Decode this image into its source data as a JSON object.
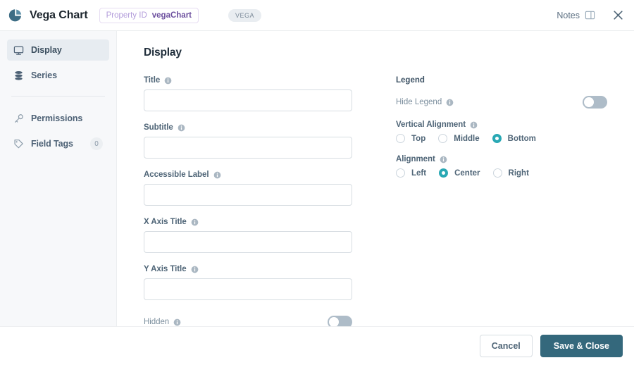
{
  "header": {
    "logo_icon": "pie-chart-icon",
    "title": "Vega Chart",
    "property_pill": {
      "label": "Property ID",
      "value": "vegaChart"
    },
    "type_badge": "VEGA",
    "notes_label": "Notes",
    "notes_icon": "panel-icon",
    "close_icon": "close-x-icon",
    "accent_purple": "#6c4f9e",
    "accent_lavender": "#b39ddb"
  },
  "sidebar": {
    "items": [
      {
        "label": "Display",
        "icon": "monitor-icon",
        "active": true,
        "count": null
      },
      {
        "label": "Series",
        "icon": "database-icon",
        "active": false,
        "count": null
      },
      {
        "label": "Permissions",
        "icon": "key-icon",
        "active": false,
        "count": null
      },
      {
        "label": "Field Tags",
        "icon": "tag-icon",
        "active": false,
        "count": "0"
      }
    ],
    "active_bg": "#e7ecf1"
  },
  "main": {
    "section_title": "Display",
    "left_fields": [
      {
        "label": "Title",
        "value": "",
        "placeholder": "",
        "info": true
      },
      {
        "label": "Subtitle",
        "value": "",
        "placeholder": "",
        "info": true
      },
      {
        "label": "Accessible Label",
        "value": "",
        "placeholder": "",
        "info": true
      },
      {
        "label": "X Axis Title",
        "value": "",
        "placeholder": "",
        "info": true
      },
      {
        "label": "Y Axis Title",
        "value": "",
        "placeholder": "",
        "info": true
      }
    ],
    "hidden_toggle": {
      "label": "Hidden",
      "info": true,
      "on": false
    },
    "legend": {
      "group_title": "Legend",
      "hide_legend": {
        "label": "Hide Legend",
        "info": true,
        "on": false
      },
      "vertical_alignment": {
        "label": "Vertical Alignment",
        "info": true,
        "options": [
          "Top",
          "Middle",
          "Bottom"
        ],
        "selected": "Bottom"
      },
      "alignment": {
        "label": "Alignment",
        "info": true,
        "options": [
          "Left",
          "Center",
          "Right"
        ],
        "selected": "Center"
      },
      "selected_color": "#29a8b4"
    }
  },
  "footer": {
    "cancel_label": "Cancel",
    "save_label": "Save & Close",
    "primary_color": "#34687c"
  }
}
